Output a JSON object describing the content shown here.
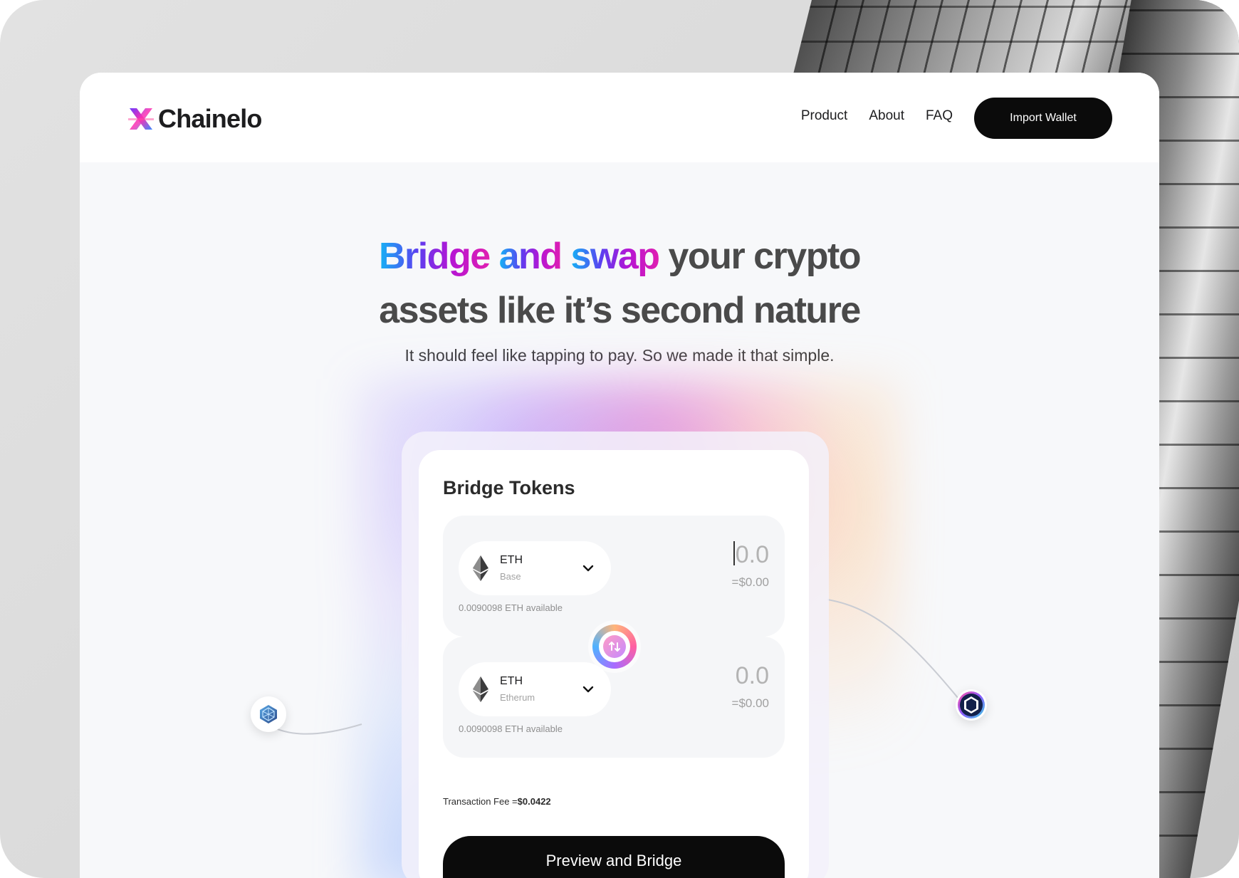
{
  "brand": {
    "name": "Chainelo",
    "accent_gradient": [
      "#14b4f5",
      "#5b3ef0",
      "#b515d4",
      "#e01fb0"
    ]
  },
  "nav": {
    "items": [
      {
        "label": "Product"
      },
      {
        "label": "About"
      },
      {
        "label": "FAQ"
      }
    ],
    "cta_label": "Import Wallet"
  },
  "hero": {
    "title_grad_1": "Bridge",
    "title_grad_2": "and",
    "title_grad_3": "swap",
    "title_rest_1": "your crypto",
    "title_line_2": "assets like it’s second nature",
    "subtitle": "It should feel like tapping to pay. So we made it that simple."
  },
  "bridge": {
    "title": "Bridge Tokens",
    "from": {
      "token": "ETH",
      "chain": "Base",
      "amount": "0.0",
      "usd": "=$0.00",
      "available": "0.0090098 ETH available",
      "icon": "ethereum-icon"
    },
    "to": {
      "token": "ETH",
      "chain": "Etherum",
      "amount": "0.0",
      "usd": "=$0.00",
      "available": "0.0090098 ETH available",
      "icon": "ethereum-icon"
    },
    "fee_label": "Transaction Fee =",
    "fee_value": "$0.0422",
    "cta_label": "Preview and Bridge"
  },
  "decor": {
    "left_node_icon": "blockchain-node-icon",
    "right_node_icon": "chain-node-icon"
  }
}
